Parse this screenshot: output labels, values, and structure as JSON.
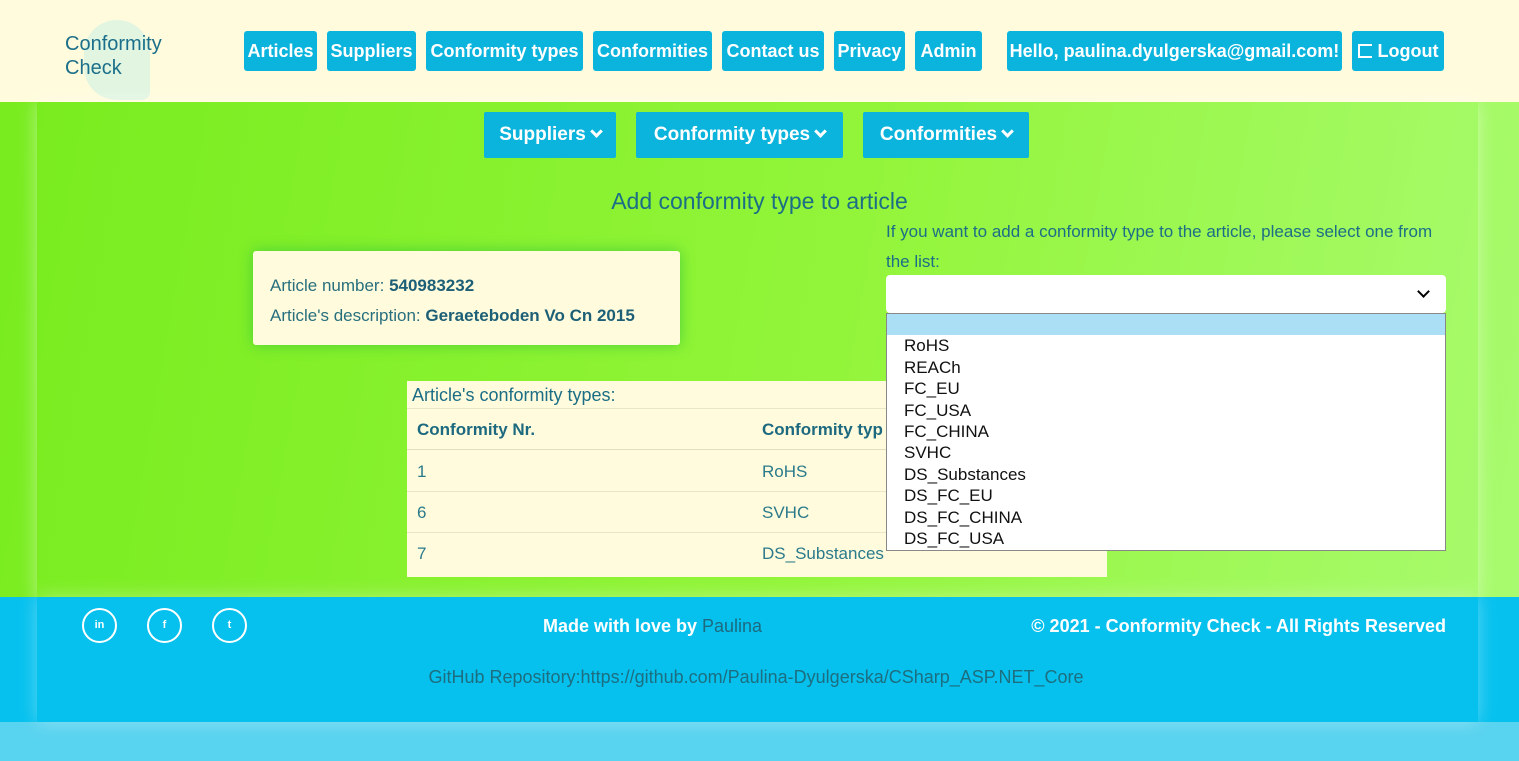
{
  "brand": {
    "line1": "Conformity",
    "line2": "Check"
  },
  "nav": {
    "articles": "Articles",
    "suppliers": "Suppliers",
    "conformity_types": "Conformity types",
    "conformities": "Conformities",
    "contact": "Contact us",
    "privacy": "Privacy",
    "admin": "Admin",
    "greeting": "Hello, paulina.dyulgerska@gmail.com!",
    "logout": "Logout"
  },
  "submenu": {
    "suppliers": "Suppliers",
    "conformity_types": "Conformity types",
    "conformities": "Conformities"
  },
  "page": {
    "title": "Add conformity type to article",
    "article_number_label": "Article number:",
    "article_number": "540983232",
    "article_desc_label": "Article's description:",
    "article_desc": "Geraeteboden Vo Cn 2015",
    "select_label": "If you want to add a conformity type to the article, please select one from the list:",
    "select_value": ""
  },
  "dropdown_options": [
    "",
    "RoHS",
    "REACh",
    "FC_EU",
    "FC_USA",
    "FC_CHINA",
    "SVHC",
    "DS_Substances",
    "DS_FC_EU",
    "DS_FC_CHINA",
    "DS_FC_USA"
  ],
  "table": {
    "caption": "Article's conformity types:",
    "headers": [
      "Conformity Nr.",
      "Conformity typ"
    ],
    "rows": [
      [
        "1",
        "RoHS"
      ],
      [
        "6",
        "SVHC"
      ],
      [
        "7",
        "DS_Substances"
      ]
    ]
  },
  "footer": {
    "social": [
      "in",
      "f",
      "t"
    ],
    "made_with": "Made with love by",
    "author": "Paulina",
    "copyright": "© 2021 - Conformity Check - All Rights Reserved",
    "github": "GitHub Repository:https://github.com/Paulina-Dyulgerska/CSharp_ASP.NET_Core"
  },
  "colors": {
    "accent": "#0bb4dc",
    "header_bg": "#fffbdc",
    "main_green": "#88ef2e",
    "footer_bg": "#06c1ee"
  }
}
